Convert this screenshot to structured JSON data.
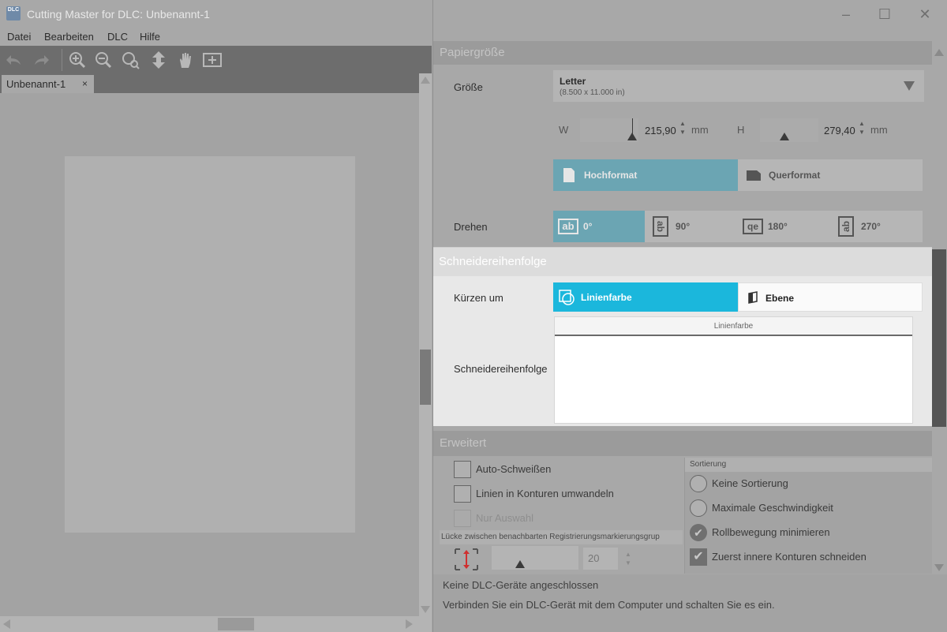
{
  "left_window": {
    "title": "Cutting Master for DLC: Unbenannt-1",
    "app_icon_text": "DLC",
    "menu": [
      "Datei",
      "Bearbeiten",
      "DLC",
      "Hilfe"
    ],
    "toolbar_icons": [
      "undo-icon",
      "redo-icon",
      "zoom-in-icon",
      "zoom-out-icon",
      "zoom-page-icon",
      "pan-move-icon",
      "hand-icon",
      "fit-icon"
    ],
    "tab_label": "Unbenannt-1",
    "tab_close": "×"
  },
  "right_window": {
    "window_controls": [
      "–",
      "☐",
      "✕"
    ],
    "papier": {
      "header": "Papiergröße",
      "size_label": "Größe",
      "size_value": "Letter",
      "size_sub": "(8.500 x 11.000 in)",
      "w_label": "W",
      "w_value": "215,90",
      "h_label": "H",
      "h_value": "279,40",
      "unit": "mm",
      "orientation": [
        {
          "label": "Hochformat",
          "active": true
        },
        {
          "label": "Querformat",
          "active": false
        }
      ],
      "rotate_label": "Drehen",
      "rotations": [
        {
          "label": "0°",
          "icon": "ab",
          "active": true
        },
        {
          "label": "90°",
          "icon": "ab",
          "active": false
        },
        {
          "label": "180°",
          "icon": "qe",
          "active": false
        },
        {
          "label": "270°",
          "icon": "ab",
          "active": false
        }
      ]
    },
    "schneide": {
      "header": "Schneidereihenfolge",
      "sort_by_label": "Kürzen um",
      "sort_by": [
        {
          "label": "Linienfarbe",
          "active": true
        },
        {
          "label": "Ebene",
          "active": false
        }
      ],
      "order_label": "Schneidereihenfolge",
      "list_column": "Linienfarbe"
    },
    "erweitert": {
      "header": "Erweitert",
      "checkboxes": [
        {
          "label": "Auto-Schweißen",
          "checked": false,
          "disabled": false
        },
        {
          "label": "Linien in Konturen umwandeln",
          "checked": false,
          "disabled": false
        },
        {
          "label": "Nur Auswahl",
          "checked": false,
          "disabled": true
        }
      ],
      "gap_label": "Lücke zwischen benachbarten Registrierungsmarkierungsgrup",
      "gap_value": "20",
      "sort_group_label": "Sortierung",
      "sort_options": [
        {
          "label": "Keine Sortierung",
          "type": "radio",
          "checked": false
        },
        {
          "label": "Maximale Geschwindigkeit",
          "type": "radio",
          "checked": false
        },
        {
          "label": "Rollbewegung minimieren",
          "type": "radio",
          "checked": true
        },
        {
          "label": "Zuerst innere Konturen schneiden",
          "type": "checkbox",
          "checked": true
        }
      ]
    },
    "status": {
      "line1": "Keine DLC-Geräte angeschlossen",
      "line2": "Verbinden Sie ein DLC-Gerät mit dem Computer und schalten Sie es ein."
    }
  },
  "colors": {
    "accent": "#1bb7dc",
    "accent_dimmed": "#6ba5b3"
  }
}
